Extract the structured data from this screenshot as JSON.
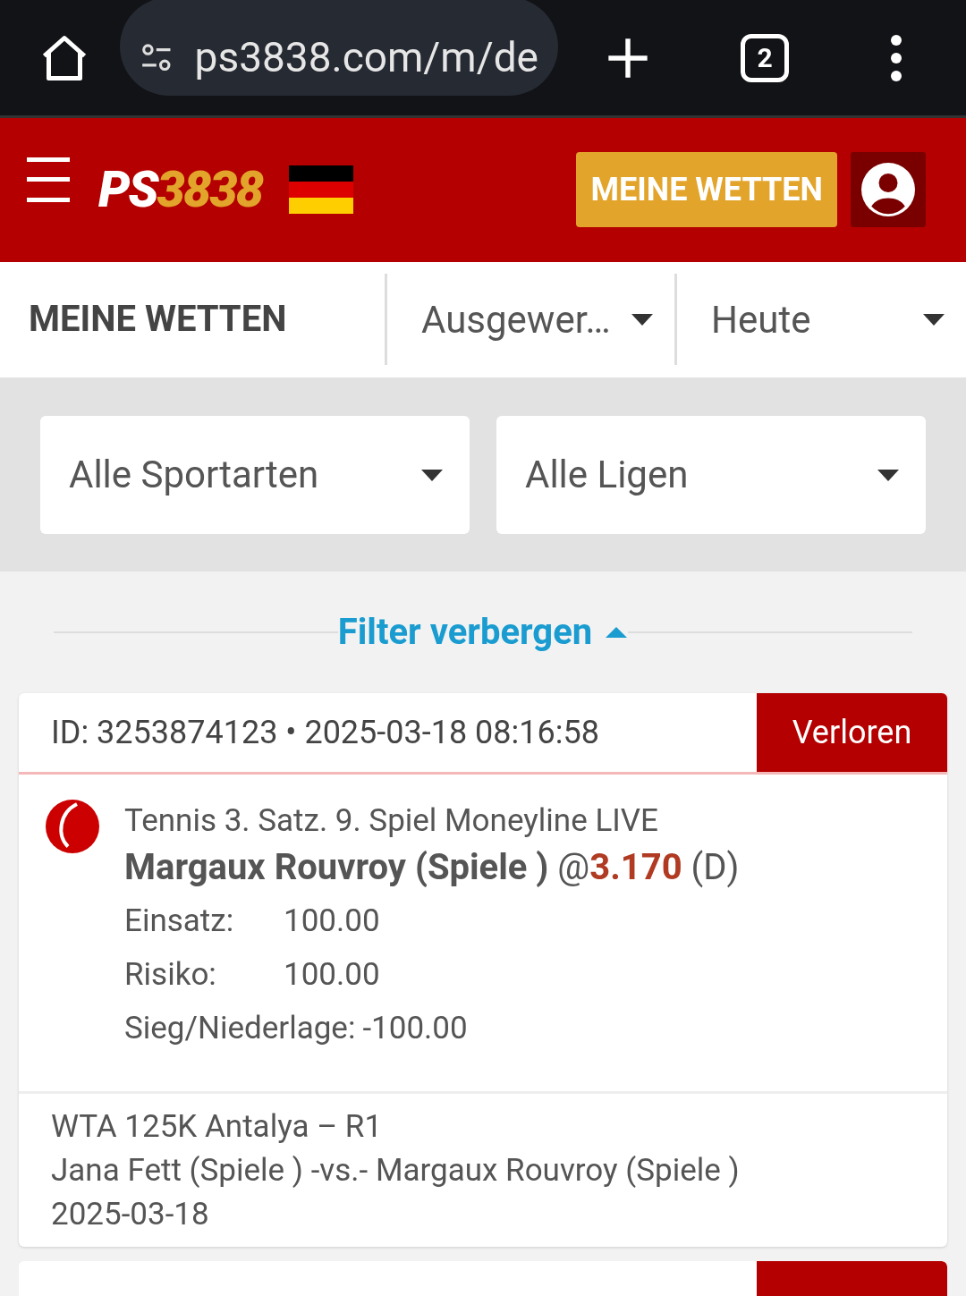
{
  "browser": {
    "url": "ps3838.com/m/de",
    "tab_count": "2"
  },
  "header": {
    "logo_a": "PS",
    "logo_b": "3838",
    "my_bets_button": "MEINE WETTEN"
  },
  "subnav": {
    "title": "MEINE WETTEN",
    "status_dropdown": "Ausgewer…",
    "period_dropdown": "Heute"
  },
  "filters": {
    "sports": "Alle Sportarten",
    "leagues": "Alle Ligen",
    "toggle": "Filter verbergen"
  },
  "bets": [
    {
      "id_line": "ID: 3253874123 • 2025-03-18 08:16:58",
      "status": "Verloren",
      "market": "Tennis 3. Satz. 9. Spiel Moneyline LIVE",
      "selection": "Margaux Rouvroy (Spiele )",
      "at": "@",
      "odds": "3.170",
      "odds_format": "(D)",
      "stake_label": "Einsatz:",
      "stake": "100.00",
      "risk_label": "Risiko:",
      "risk": "100.00",
      "result_label": "Sieg/Niederlage:",
      "result": "-100.00",
      "league": "WTA 125K Antalya – R1",
      "match": "Jana Fett (Spiele ) -vs.- Margaux Rouvroy (Spiele )",
      "date": "2025-03-18"
    }
  ]
}
